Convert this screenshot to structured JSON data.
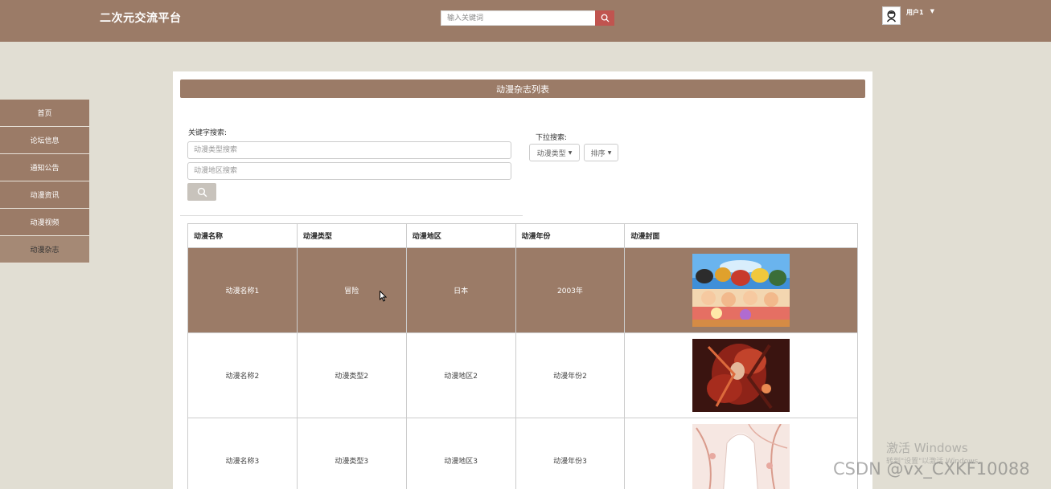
{
  "header": {
    "brand": "二次元交流平台",
    "search_placeholder": "输入关键词",
    "user_name": "用户1"
  },
  "sidebar": {
    "items": [
      {
        "label": "首页"
      },
      {
        "label": "论坛信息"
      },
      {
        "label": "通知公告"
      },
      {
        "label": "动漫资讯"
      },
      {
        "label": "动漫视频"
      },
      {
        "label": "动漫杂志",
        "active": true
      }
    ]
  },
  "main": {
    "title": "动漫杂志列表",
    "keyword_label": "关键字搜索:",
    "type_placeholder": "动漫类型搜索",
    "region_placeholder": "动漫地区搜索",
    "dropdown_label": "下拉搜索:",
    "dropdown_type": "动漫类型",
    "dropdown_sort": "排序"
  },
  "table": {
    "headers": [
      "动漫名称",
      "动漫类型",
      "动漫地区",
      "动漫年份",
      "动漫封面"
    ],
    "rows": [
      {
        "name": "动漫名称1",
        "type": "冒险",
        "region": "日本",
        "year": "2003年"
      },
      {
        "name": "动漫名称2",
        "type": "动漫类型2",
        "region": "动漫地区2",
        "year": "动漫年份2"
      },
      {
        "name": "动漫名称3",
        "type": "动漫类型3",
        "region": "动漫地区3",
        "year": "动漫年份3"
      }
    ]
  },
  "watermark": {
    "activate": "激活 Windows",
    "activate_sub": "转到\"设置\"以激活 Windows。",
    "csdn": "CSDN @vx_CXKF10088"
  },
  "colors": {
    "brand": "#9b7b67",
    "background": "#e1ded3",
    "search_button": "#c0544f"
  }
}
